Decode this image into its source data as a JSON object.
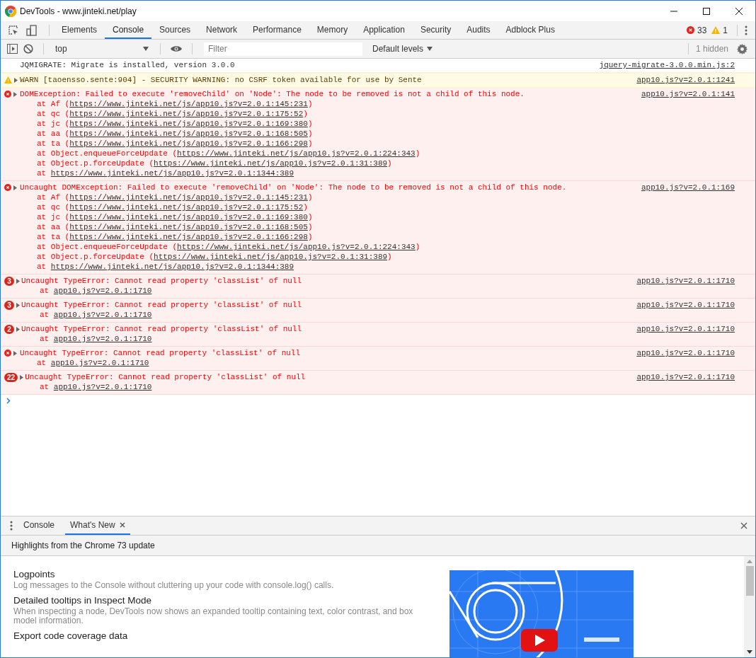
{
  "window": {
    "title": "DevTools - www.jinteki.net/play"
  },
  "tabs": [
    {
      "label": "Elements",
      "selected": false
    },
    {
      "label": "Console",
      "selected": true
    },
    {
      "label": "Sources",
      "selected": false
    },
    {
      "label": "Network",
      "selected": false
    },
    {
      "label": "Performance",
      "selected": false
    },
    {
      "label": "Memory",
      "selected": false
    },
    {
      "label": "Application",
      "selected": false
    },
    {
      "label": "Security",
      "selected": false
    },
    {
      "label": "Audits",
      "selected": false
    },
    {
      "label": "Adblock Plus",
      "selected": false
    }
  ],
  "counters": {
    "errors": "33",
    "warnings": "1"
  },
  "toolbar": {
    "context": "top",
    "filter_placeholder": "Filter",
    "levels": "Default levels",
    "hidden": "1 hidden"
  },
  "messages": [
    {
      "kind": "log",
      "text": "JQMIGRATE: Migrate is installed, version 3.0.0",
      "source": "jquery-migrate-3.0.0.min.js:2"
    },
    {
      "kind": "warn",
      "text": "WARN [taoensso.sente:904] - SECURITY WARNING: no CSRF token available for use by Sente",
      "source": "app10.js?v=2.0.1:1241"
    },
    {
      "kind": "error",
      "text": "DOMException: Failed to execute 'removeChild' on 'Node': The node to be removed is not a child of this node.",
      "source": "app10.js?v=2.0.1:141",
      "stack": [
        {
          "before": "at Af (",
          "link": "https://www.jinteki.net/js/app10.js?v=2.0.1:145:231",
          "after": ")"
        },
        {
          "before": "at qc (",
          "link": "https://www.jinteki.net/js/app10.js?v=2.0.1:175:52",
          "after": ")"
        },
        {
          "before": "at jc (",
          "link": "https://www.jinteki.net/js/app10.js?v=2.0.1:169:380",
          "after": ")"
        },
        {
          "before": "at aa (",
          "link": "https://www.jinteki.net/js/app10.js?v=2.0.1:168:505",
          "after": ")"
        },
        {
          "before": "at ta (",
          "link": "https://www.jinteki.net/js/app10.js?v=2.0.1:166:298",
          "after": ")"
        },
        {
          "before": "at Object.enqueueForceUpdate (",
          "link": "https://www.jinteki.net/js/app10.js?v=2.0.1:224:343",
          "after": ")"
        },
        {
          "before": "at Object.p.forceUpdate (",
          "link": "https://www.jinteki.net/js/app10.js?v=2.0.1:31:389",
          "after": ")"
        },
        {
          "before": "at ",
          "link": "https://www.jinteki.net/js/app10.js?v=2.0.1:1344:389"
        }
      ]
    },
    {
      "kind": "error",
      "text": "Uncaught DOMException: Failed to execute 'removeChild' on 'Node': The node to be removed is not a child of this node.",
      "source": "app10.js?v=2.0.1:169",
      "stack": [
        {
          "before": "at Af (",
          "link": "https://www.jinteki.net/js/app10.js?v=2.0.1:145:231",
          "after": ")"
        },
        {
          "before": "at qc (",
          "link": "https://www.jinteki.net/js/app10.js?v=2.0.1:175:52",
          "after": ")"
        },
        {
          "before": "at jc (",
          "link": "https://www.jinteki.net/js/app10.js?v=2.0.1:169:380",
          "after": ")"
        },
        {
          "before": "at aa (",
          "link": "https://www.jinteki.net/js/app10.js?v=2.0.1:168:505",
          "after": ")"
        },
        {
          "before": "at ta (",
          "link": "https://www.jinteki.net/js/app10.js?v=2.0.1:166:298",
          "after": ")"
        },
        {
          "before": "at Object.enqueueForceUpdate (",
          "link": "https://www.jinteki.net/js/app10.js?v=2.0.1:224:343",
          "after": ")"
        },
        {
          "before": "at Object.p.forceUpdate (",
          "link": "https://www.jinteki.net/js/app10.js?v=2.0.1:31:389",
          "after": ")"
        },
        {
          "before": "at ",
          "link": "https://www.jinteki.net/js/app10.js?v=2.0.1:1344:389"
        }
      ]
    },
    {
      "kind": "error",
      "count": "3",
      "text": "Uncaught TypeError: Cannot read property 'classList' of null",
      "source": "app10.js?v=2.0.1:1710",
      "stack": [
        {
          "before": "at ",
          "link": "app10.js?v=2.0.1:1710"
        }
      ]
    },
    {
      "kind": "error",
      "count": "3",
      "text": "Uncaught TypeError: Cannot read property 'classList' of null",
      "source": "app10.js?v=2.0.1:1710",
      "stack": [
        {
          "before": "at ",
          "link": "app10.js?v=2.0.1:1710"
        }
      ]
    },
    {
      "kind": "error",
      "count": "2",
      "text": "Uncaught TypeError: Cannot read property 'classList' of null",
      "source": "app10.js?v=2.0.1:1710",
      "stack": [
        {
          "before": "at ",
          "link": "app10.js?v=2.0.1:1710"
        }
      ]
    },
    {
      "kind": "error",
      "text": "Uncaught TypeError: Cannot read property 'classList' of null",
      "source": "app10.js?v=2.0.1:1710",
      "stack": [
        {
          "before": "at ",
          "link": "app10.js?v=2.0.1:1710"
        }
      ]
    },
    {
      "kind": "error",
      "count": "22",
      "text": "Uncaught TypeError: Cannot read property 'classList' of null",
      "source": "app10.js?v=2.0.1:1710",
      "stack": [
        {
          "before": "at ",
          "link": "app10.js?v=2.0.1:1710"
        }
      ]
    }
  ],
  "drawer": {
    "tabs": [
      {
        "label": "Console",
        "selected": false,
        "closable": false
      },
      {
        "label": "What's New",
        "selected": true,
        "closable": true
      }
    ],
    "heading": "Highlights from the Chrome 73 update",
    "items": [
      {
        "title": "Logpoints",
        "description": "Log messages to the Console without cluttering up your code with console.log() calls."
      },
      {
        "title": "Detailed tooltips in Inspect Mode",
        "description": "When inspecting a node, DevTools now shows an expanded tooltip containing text, color contrast, and box model information."
      },
      {
        "title": "Export code coverage data"
      }
    ]
  }
}
